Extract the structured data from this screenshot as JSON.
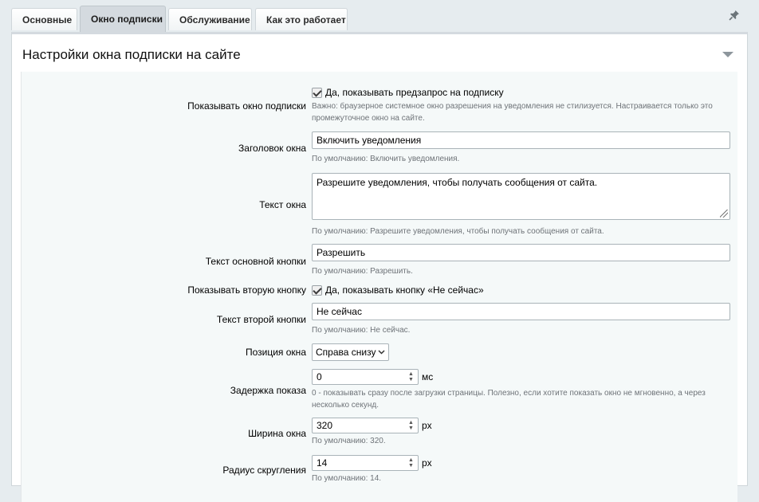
{
  "tabs": [
    {
      "label": "Основные",
      "active": false
    },
    {
      "label": "Окно подписки",
      "active": true
    },
    {
      "label": "Обслуживание",
      "active": false
    },
    {
      "label": "Как это работает",
      "active": false
    }
  ],
  "section": {
    "title": "Настройки окна подписки на сайте"
  },
  "form": {
    "show_prompt": {
      "label": "Показывать окно подписки",
      "checkbox_label": "Да, показывать предзапрос на подписку",
      "checked": true,
      "hint": "Важно: браузерное системное окно разрешения на уведомления не стилизуется. Настраивается только это промежуточное окно на сайте."
    },
    "title": {
      "label": "Заголовок окна",
      "value": "Включить уведомления",
      "hint": "По умолчанию: Включить уведомления."
    },
    "text": {
      "label": "Текст окна",
      "value": "Разрешите уведомления, чтобы получать сообщения от сайта.",
      "hint": "По умолчанию: Разрешите уведомления, чтобы получать сообщения от сайта."
    },
    "primary_button": {
      "label": "Текст основной кнопки",
      "value": "Разрешить",
      "hint": "По умолчанию: Разрешить."
    },
    "show_second": {
      "label": "Показывать вторую кнопку",
      "checkbox_label": "Да, показывать кнопку «Не сейчас»",
      "checked": true
    },
    "second_button": {
      "label": "Текст второй кнопки",
      "value": "Не сейчас",
      "hint": "По умолчанию: Не сейчас."
    },
    "position": {
      "label": "Позиция окна",
      "value": "Справа снизу"
    },
    "delay": {
      "label": "Задержка показа",
      "value": "0",
      "unit": "мс",
      "hint": "0 - показывать сразу после загрузки страницы. Полезно, если хотите показать окно не мгновенно, а через несколько секунд."
    },
    "width": {
      "label": "Ширина окна",
      "value": "320",
      "unit": "px",
      "hint": "По умолчанию: 320."
    },
    "radius": {
      "label": "Радиус скругления",
      "value": "14",
      "unit": "px",
      "hint": "По умолчанию: 14."
    }
  }
}
